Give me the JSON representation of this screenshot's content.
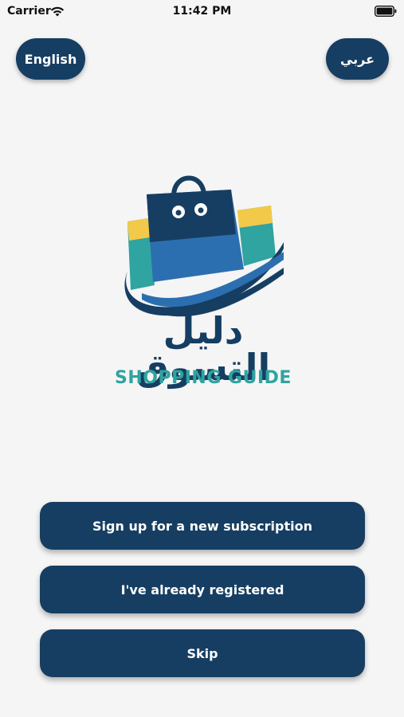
{
  "status_bar": {
    "carrier": "Carrier",
    "time": "11:42 PM"
  },
  "language": {
    "english_label": "English",
    "arabic_label": "عربي"
  },
  "logo": {
    "arabic_name": "دليل التسوق",
    "english_name": "SHOPPING GUIDE"
  },
  "actions": {
    "signup_label": "Sign up for a new subscription",
    "registered_label": "I've already registered",
    "skip_label": "Skip"
  },
  "colors": {
    "primary": "#163e62",
    "accent_teal": "#2fa4a0",
    "accent_yellow": "#f3c94a",
    "accent_blue": "#2c6fb0",
    "background": "#f5f5f5"
  }
}
